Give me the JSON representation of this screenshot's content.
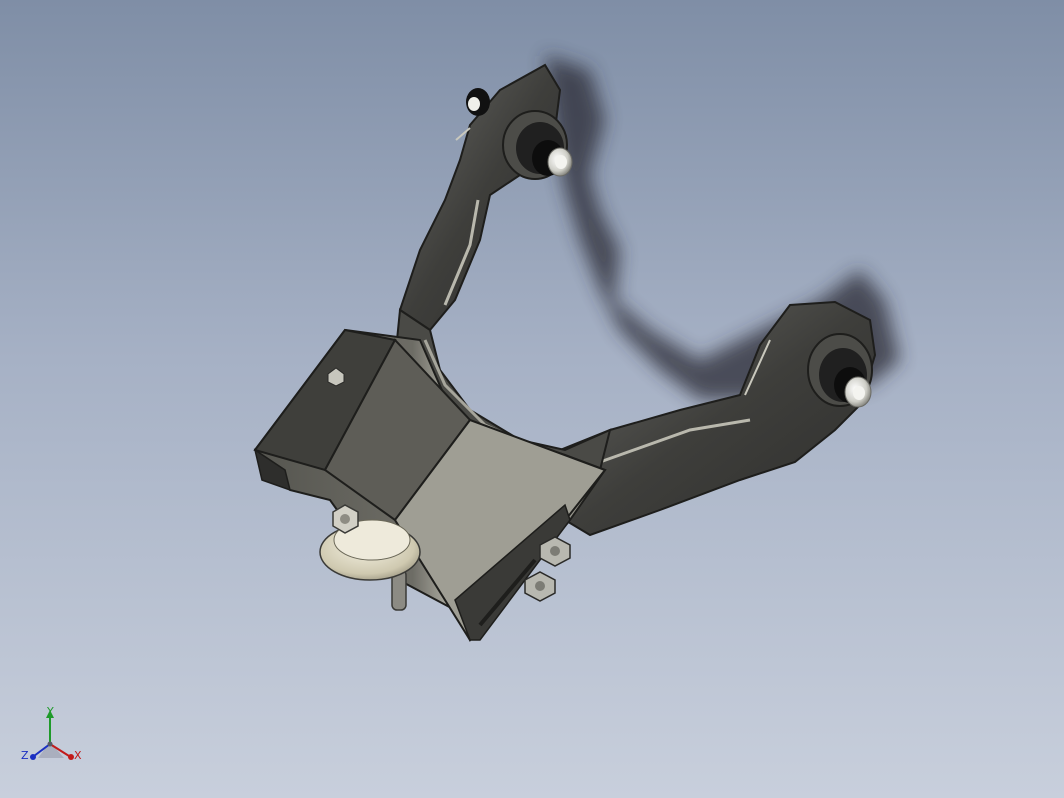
{
  "viewport": {
    "background_top": "#7f8ea6",
    "background_bottom": "#c8cfdc",
    "model": {
      "part_shade_dark": "#3c3c3a",
      "part_shade_mid": "#5a5a56",
      "part_shade_light": "#a7a69c",
      "shadow_color": "#2a2c36"
    }
  },
  "triad": {
    "x_label": "X",
    "y_label": "Y",
    "z_label": "Z",
    "x_color": "#c21a1a",
    "y_color": "#1f9a2a",
    "z_color": "#1a2fc2"
  }
}
